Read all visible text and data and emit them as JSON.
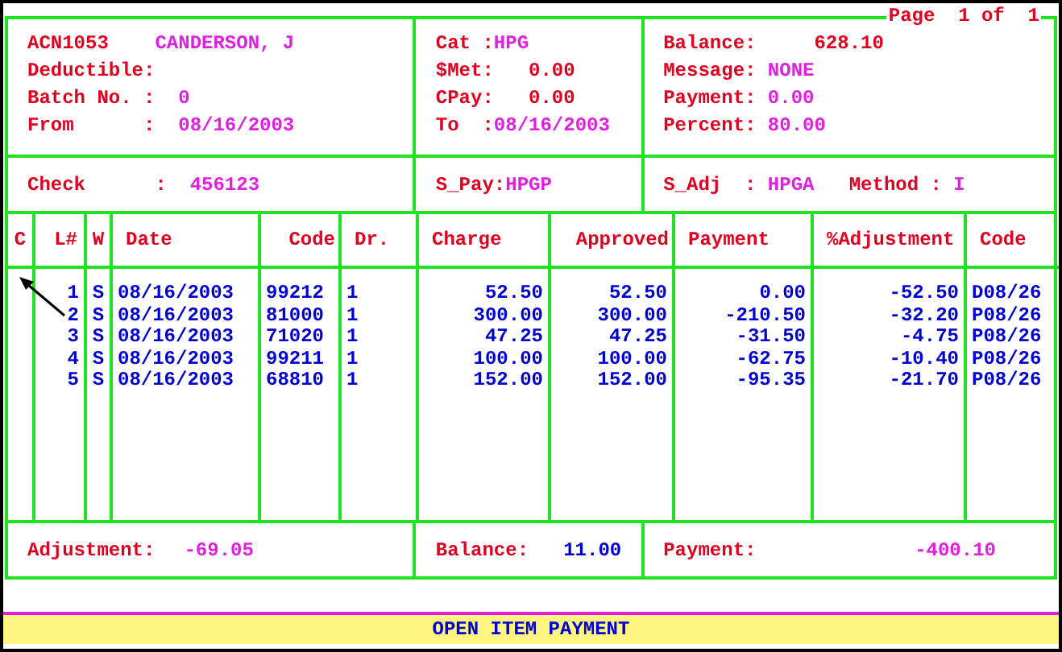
{
  "page_label": "Page  1 of  1",
  "header": {
    "panels": [
      {
        "fields": [
          {
            "label": "ACN1053    ",
            "value": "CANDERSON, J",
            "color": "#e020e0"
          },
          {
            "label": "Deductible:"
          },
          {
            "label": "Batch No. :  ",
            "value": "0",
            "color": "#e020e0"
          },
          {
            "label": "From      :  ",
            "value": "08/16/2003",
            "color": "#e020e0"
          }
        ]
      },
      {
        "fields": [
          {
            "label": "Cat :",
            "value": "HPG",
            "color": "#e020e0"
          },
          {
            "label": "$Met:   ",
            "value": "0.00",
            "color": "#e00020"
          },
          {
            "label": "CPay:   ",
            "value": "0.00",
            "color": "#e00020"
          },
          {
            "label": "To  :",
            "value": "08/16/2003",
            "color": "#e020e0"
          }
        ]
      },
      {
        "fields": [
          {
            "label": "Balance:     ",
            "value": "628.10",
            "color": "#e00020"
          },
          {
            "label": "Message: ",
            "value": "NONE",
            "color": "#e020e0"
          },
          {
            "label": "Payment: ",
            "value": "0.00",
            "color": "#e020e0"
          },
          {
            "label": "Percent: ",
            "value": "80.00",
            "color": "#e020e0"
          }
        ]
      }
    ]
  },
  "check_row": [
    {
      "fields": [
        {
          "label": "Check      :  ",
          "value": "456123",
          "color": "#e020e0"
        }
      ]
    },
    {
      "fields": [
        {
          "label": "S_Pay:",
          "value": "HPGP",
          "color": "#e020e0"
        }
      ]
    },
    {
      "fields": [
        {
          "label": "S_Adj  : ",
          "value": "HPGA",
          "color": "#e020e0"
        },
        {
          "label": "   Method : ",
          "value": "I",
          "color": "#e020e0"
        }
      ]
    }
  ],
  "table": {
    "columns": [
      "C",
      "L#",
      "W",
      "Date",
      "Code",
      "Dr.",
      "Charge",
      "Approved",
      "Payment",
      "%Adjustment",
      "Code"
    ],
    "rows": [
      [
        "",
        "1",
        "S",
        "08/16/2003",
        "99212",
        "1",
        "52.50",
        "52.50",
        "0.00",
        "-52.50",
        "D08/26"
      ],
      [
        "",
        "2",
        "S",
        "08/16/2003",
        "81000",
        "1",
        "300.00",
        "300.00",
        "-210.50",
        "-32.20",
        "P08/26"
      ],
      [
        "",
        "3",
        "S",
        "08/16/2003",
        "71020",
        "1",
        "47.25",
        "47.25",
        "-31.50",
        "-4.75",
        "P08/26"
      ],
      [
        "",
        "4",
        "S",
        "08/16/2003",
        "99211",
        "1",
        "100.00",
        "100.00",
        "-62.75",
        "-10.40",
        "P08/26"
      ],
      [
        "",
        "5",
        "S",
        "08/16/2003",
        "68810",
        "1",
        "152.00",
        "152.00",
        "-95.35",
        "-21.70",
        "P08/26"
      ]
    ]
  },
  "totals": [
    {
      "label": "Adjustment:",
      "value": "-69.05",
      "color": "#e020e0"
    },
    {
      "label": "Balance:",
      "value": "11.00",
      "color": "#0000d0"
    },
    {
      "label": "Payment:",
      "value": "-400.10",
      "color": "#e020e0"
    }
  ],
  "status_bar": "OPEN ITEM PAYMENT"
}
